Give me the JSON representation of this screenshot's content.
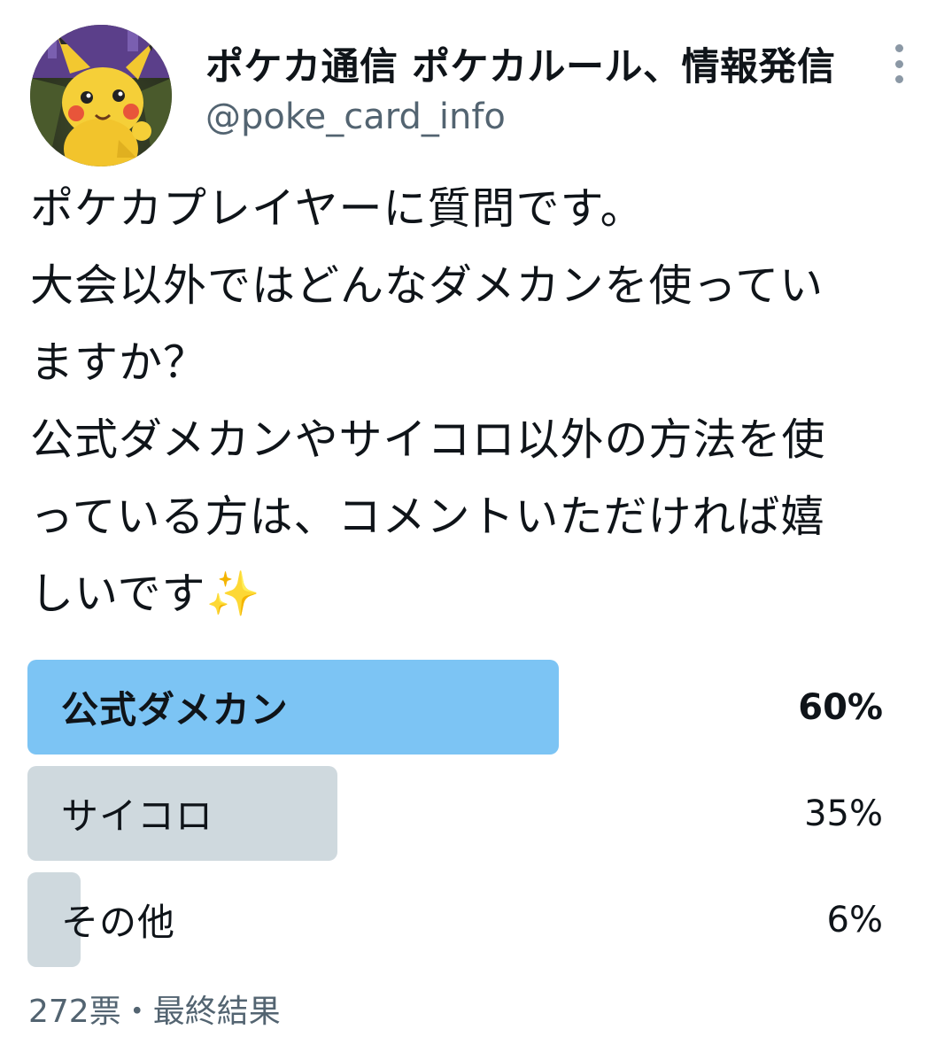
{
  "author": {
    "display_name": "ポケカ通信 ポケカルール、情報発信",
    "handle": "@poke_card_info",
    "avatar_icon": "pikachu-avatar-icon",
    "more_icon": "more-vertical-icon"
  },
  "tweet": {
    "text": "ポケカプレイヤーに質問です。\n大会以外ではどんなダメカンを使ってい\nますか？\n公式ダメカンやサイコロ以外の方法を使\nっている方は、コメントいただければ嬉\nしいです✨"
  },
  "poll": {
    "options": [
      {
        "label": "公式ダメカン",
        "percent_text": "60%",
        "value": 60,
        "winner": true
      },
      {
        "label": "サイコロ",
        "percent_text": "35%",
        "value": 35,
        "winner": false
      },
      {
        "label": "その他",
        "percent_text": "6%",
        "value": 6,
        "winner": false
      }
    ],
    "meta": "272票・最終結果"
  },
  "colors": {
    "winner_fill": "#7cc4f4",
    "option_fill": "#cfd9de",
    "secondary_text": "#536471"
  }
}
